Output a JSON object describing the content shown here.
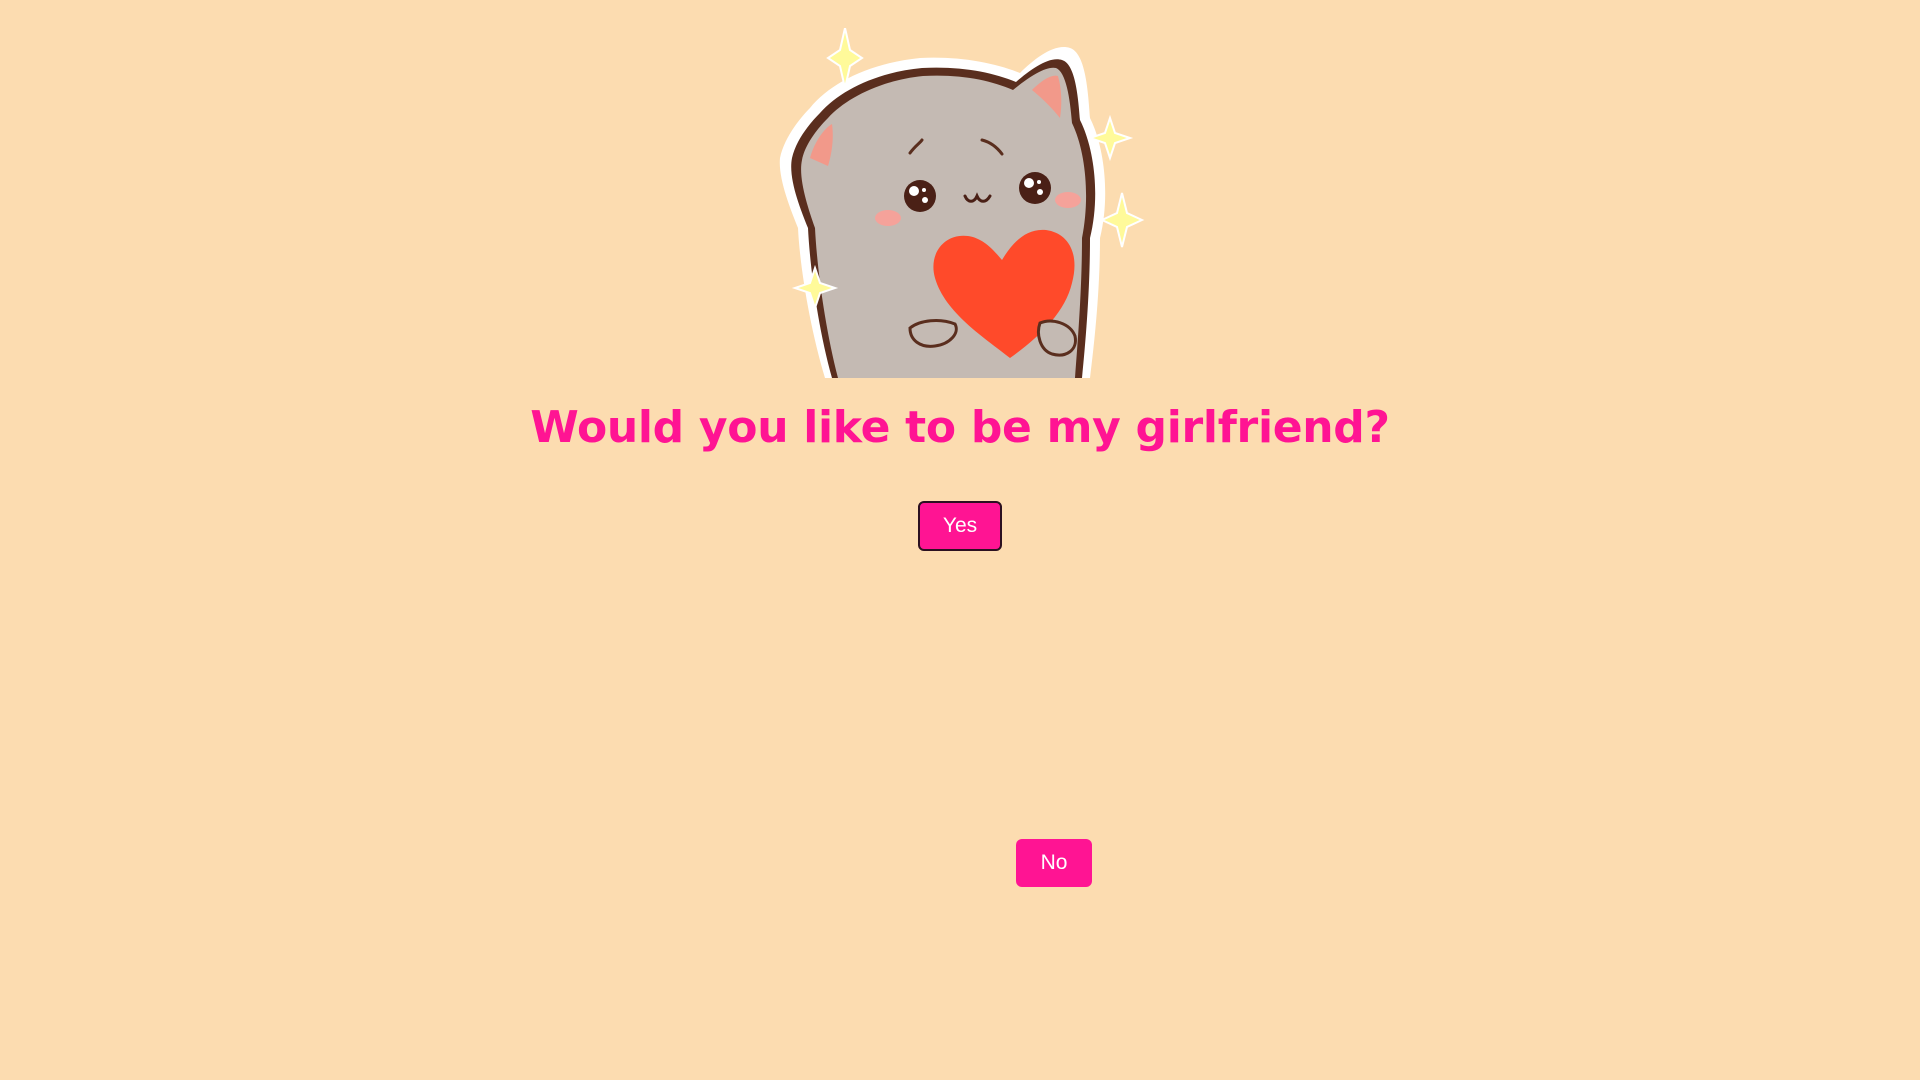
{
  "page": {
    "question": "Would you like to be my girlfriend?",
    "background_color": "#fcdcb0",
    "accent_color": "#ff1493"
  },
  "illustration": {
    "icon": "cat-holding-heart-sticker-icon"
  },
  "buttons": {
    "yes_label": "Yes",
    "no_label": "No"
  }
}
